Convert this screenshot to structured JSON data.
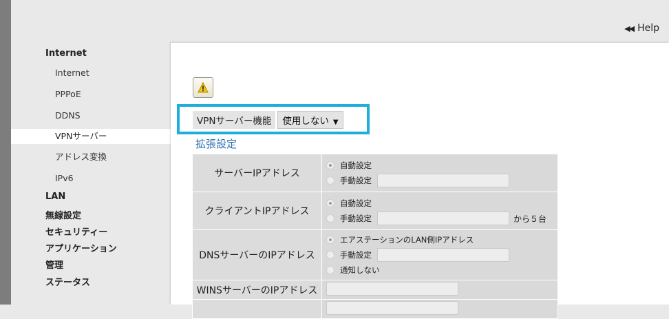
{
  "header": {
    "help_label": "Help",
    "help_icon": "double-left-arrow-icon"
  },
  "nav": {
    "internet_section": "Internet",
    "items": [
      {
        "label": "Internet"
      },
      {
        "label": "PPPoE"
      },
      {
        "label": "DDNS"
      },
      {
        "label": "VPNサーバー"
      },
      {
        "label": "アドレス変換"
      },
      {
        "label": "IPv6"
      }
    ],
    "sections": [
      "LAN",
      "無線設定",
      "セキュリティー",
      "アプリケーション",
      "管理",
      "ステータス"
    ]
  },
  "main": {
    "warning_icon": "warning-icon",
    "vpn_label": "VPNサーバー機能",
    "vpn_select_value": "使用しない",
    "ext_heading": "拡張設定",
    "rows": {
      "server_ip": {
        "label": "サーバーIPアドレス",
        "opt_auto": "自動設定",
        "opt_manual": "手動設定"
      },
      "client_ip": {
        "label": "クライアントIPアドレス",
        "opt_auto": "自動設定",
        "opt_manual": "手動設定",
        "suffix": "から５台"
      },
      "dns_ip": {
        "label": "DNSサーバーのIPアドレス",
        "opt_lan": "エアステーションのLAN側IPアドレス",
        "opt_manual": "手動設定",
        "opt_none": "通知しない"
      },
      "wins_ip": {
        "label": "WINSサーバーのIPアドレス"
      }
    }
  },
  "colors": {
    "highlight": "#1eaedb",
    "link": "#2a6fb0"
  }
}
